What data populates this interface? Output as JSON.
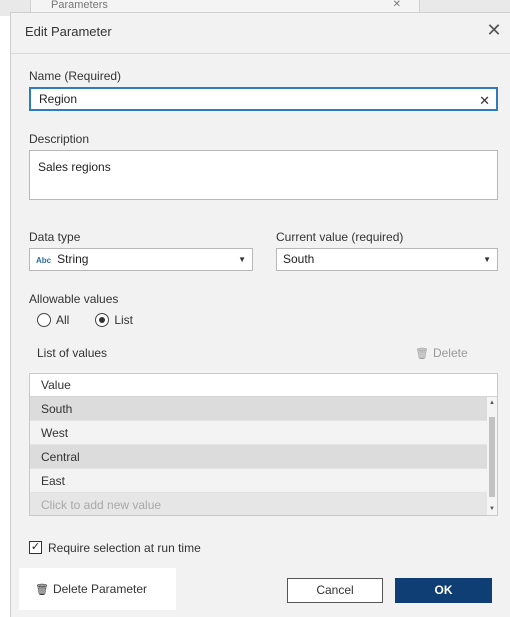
{
  "background": {
    "tab_label": "Parameters"
  },
  "dialog": {
    "title": "Edit Parameter",
    "name_label": "Name (Required)",
    "name_value": "Region",
    "description_label": "Description",
    "description_value": "Sales regions",
    "data_type_label": "Data type",
    "data_type_icon_text": "Abc",
    "data_type_value": "String",
    "current_value_label": "Current value (required)",
    "current_value_value": "South",
    "allowable_label": "Allowable values",
    "allowable_options": [
      {
        "label": "All",
        "selected": false
      },
      {
        "label": "List",
        "selected": true
      }
    ],
    "list_label": "List of values",
    "delete_values_label": "Delete",
    "table": {
      "header": "Value",
      "rows": [
        "South",
        "West",
        "Central",
        "East"
      ],
      "add_placeholder": "Click to add new value"
    },
    "require_selection_label": "Require selection at run time",
    "require_selection_checked": true,
    "delete_parameter_label": "Delete Parameter",
    "cancel_label": "Cancel",
    "ok_label": "OK"
  },
  "colors": {
    "ok_button": "#0e3e74",
    "focus_border": "#2f7bbf",
    "dialog_bg": "#f2f2f2"
  }
}
